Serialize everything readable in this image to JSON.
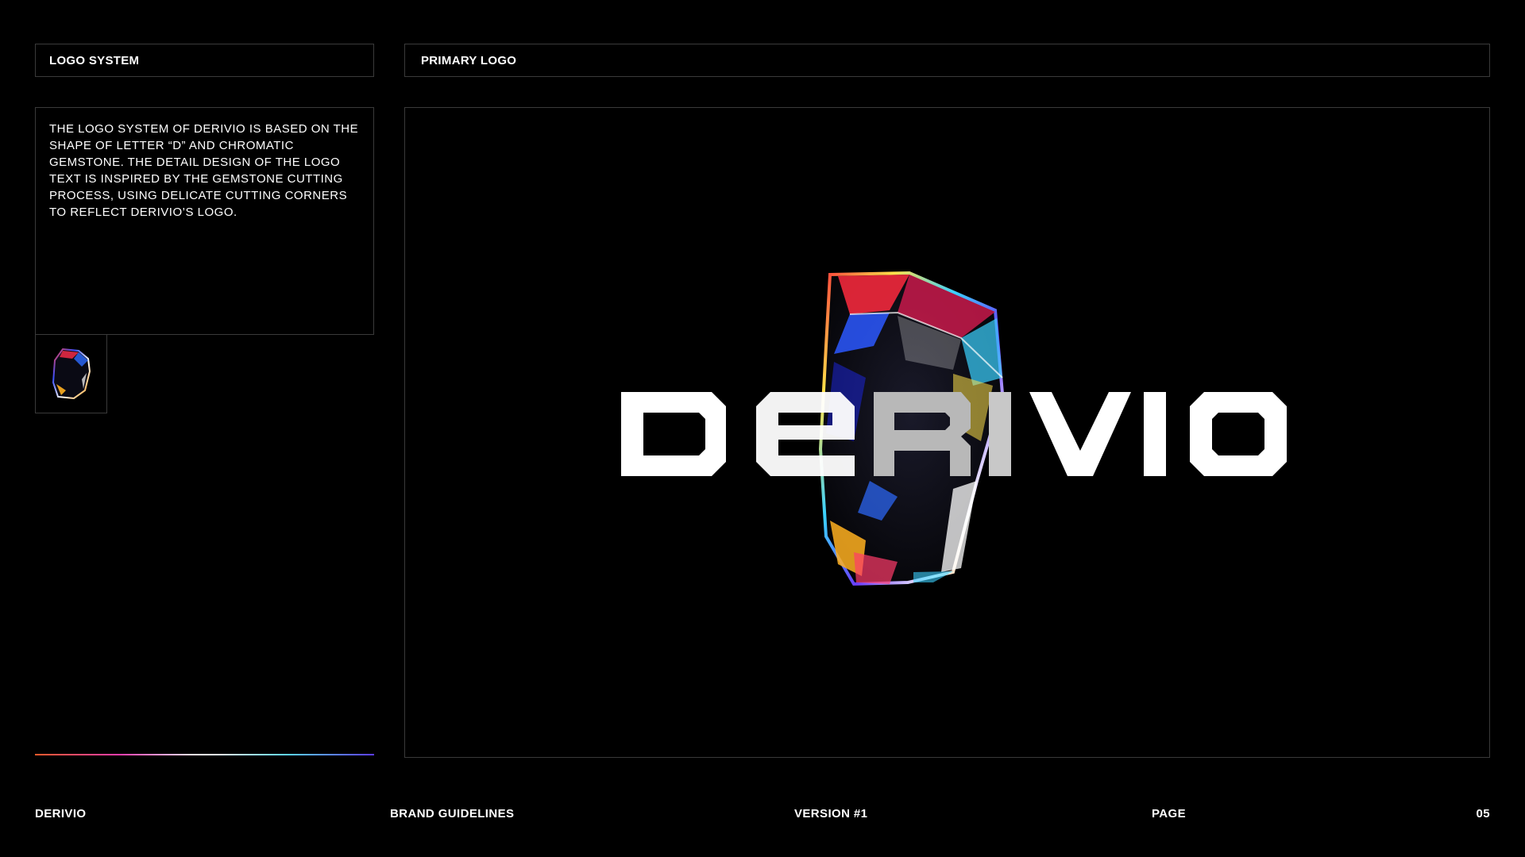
{
  "header": {
    "section_label": "LOGO SYSTEM",
    "panel_label": "PRIMARY LOGO"
  },
  "description": "THE LOGO SYSTEM OF DERIVIO IS BASED ON THE SHAPE OF LETTER “D” AND CHROMATIC GEMSTONE. THE DETAIL DESIGN OF THE LOGO TEXT IS INSPIRED BY THE GEMSTONE CUTTING PROCESS, USING DELICATE CUTTING CORNERS TO REFLECT DERIVIO’S LOGO.",
  "logo": {
    "wordmark": "DERIVIO",
    "icon": "chromatic-gemstone-icon"
  },
  "footer": {
    "brand": "DERIVIO",
    "document": "BRAND GUIDELINES",
    "version": "VERSION #1",
    "page_label": "PAGE",
    "page_number": "05"
  },
  "colors": {
    "background": "#000000",
    "border": "#3a3a3a",
    "text": "#ffffff",
    "gradient": [
      "#ff5a2a",
      "#ff3cae",
      "#ffffff",
      "#5ad2ff",
      "#5b3cff"
    ]
  }
}
